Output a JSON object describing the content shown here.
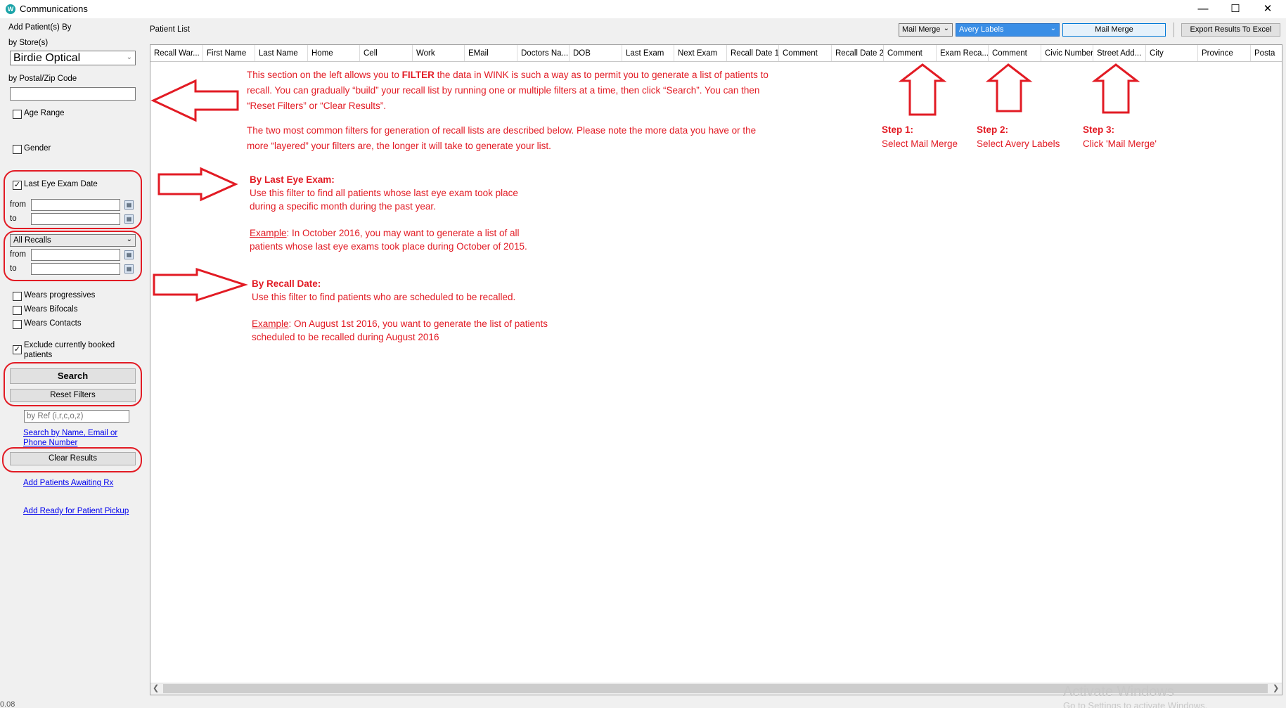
{
  "window": {
    "title": "Communications",
    "app_icon": "W"
  },
  "sidebar": {
    "add_patients_by": "Add Patient(s) By",
    "by_stores": "by Store(s)",
    "store_value": "Birdie Optical",
    "by_postal": "by Postal/Zip Code",
    "age_range": "Age Range",
    "gender": "Gender",
    "last_eye_exam": "Last Eye Exam Date",
    "from": "from",
    "to": "to",
    "recalls_value": "All Recalls",
    "wears_progressives": "Wears progressives",
    "wears_bifocals": "Wears Bifocals",
    "wears_contacts": "Wears Contacts",
    "exclude_booked": "Exclude currently booked patients",
    "search": "Search",
    "reset_filters": "Reset Filters",
    "ref_placeholder": "by Ref (i,r,c,o,z)",
    "search_by_name": "Search by Name, Email or Phone Number",
    "clear_results": "Clear Results",
    "add_awaiting_rx": "Add Patients Awaiting Rx",
    "add_ready_pickup": "Add Ready for Patient Pickup",
    "version": "0.08"
  },
  "toolbar": {
    "patient_list": "Patient List",
    "merge_type": "Mail Merge",
    "label_type": "Avery Labels",
    "mail_merge_button": "Mail Merge",
    "export_button": "Export Results To Excel"
  },
  "columns": [
    "Recall War...",
    "First Name",
    "Last Name",
    "Home",
    "Cell",
    "Work",
    "EMail",
    "Doctors Na...",
    "DOB",
    "Last Exam",
    "Next Exam",
    "Recall Date 1",
    "Comment",
    "Recall Date 2",
    "Comment",
    "Exam Reca...",
    "Comment",
    "Civic Number",
    "Street Add...",
    "City",
    "Province",
    "Posta"
  ],
  "annotations": {
    "intro_1a": "This section on the left allows you to ",
    "intro_1b": "FILTER",
    "intro_1c": " the data in WINK is such a way as to permit you to generate a list of patients to",
    "intro_2": "recall. You can gradually “build” your recall list by running one or multiple filters at a time, then click “Search”. You can then",
    "intro_3": "“Reset Filters” or “Clear Results”.",
    "intro_4": "The two most common filters for generation of recall lists are described below. Please note the more data you have or the",
    "intro_5": "more “layered” your filters are, the longer it will take to generate your list.",
    "exam_title": "By Last Eye Exam:",
    "exam_1": "Use this filter to find all patients whose last eye exam took place",
    "exam_2": "during a specific month during the past year.",
    "exam_ex_word": "Example",
    "exam_ex_1": ": In October 2016, you may want to generate a list of all",
    "exam_ex_2": "patients whose last eye exams took place during October of 2015.",
    "recall_title": "By Recall Date:",
    "recall_1": "Use this filter to find patients who are scheduled to be recalled.",
    "recall_ex_word": "Example",
    "recall_ex_1": ": On August 1st 2016, you want to generate the list of patients",
    "recall_ex_2": "scheduled to be recalled during August 2016",
    "step1_title": "Step 1:",
    "step1_text": "Select Mail Merge",
    "step2_title": "Step 2:",
    "step2_text": "Select Avery Labels",
    "step3_title": "Step 3:",
    "step3_text": "Click 'Mail Merge'"
  },
  "watermark": {
    "line1": "Activate Windows",
    "line2": "Go to Settings to activate Windows."
  },
  "colors": {
    "annotation_red": "#e21b24",
    "selected_blue": "#3a8ee6"
  }
}
